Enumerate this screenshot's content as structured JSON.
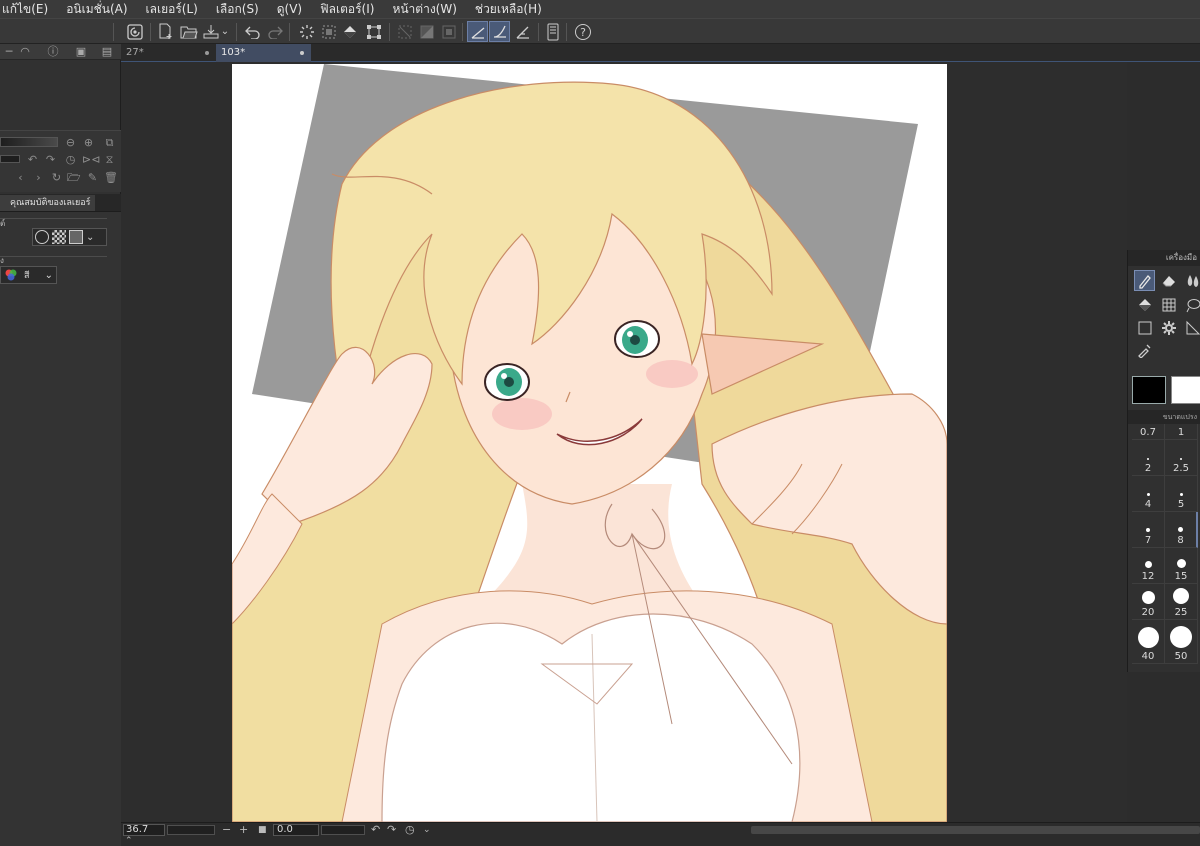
{
  "menu": {
    "items": [
      "แก้ไข(E)",
      "อนิเมชั่น(A)",
      "เลเยอร์(L)",
      "เลือก(S)",
      "ดู(V)",
      "ฟิลเตอร์(I)",
      "หน้าต่าง(W)",
      "ช่วยเหลือ(H)"
    ]
  },
  "toolbar": {
    "icons": [
      "logo-icon",
      "new-file-icon",
      "open-file-icon",
      "save-icon",
      "undo-icon",
      "redo-icon",
      "loading-icon",
      "select-all-icon",
      "fill-icon",
      "transform-icon",
      "deselect-icon",
      "invert-icon",
      "crop-icon",
      "ruler-snap-icon",
      "curve-snap-icon",
      "perspective-snap-icon",
      "device-icon",
      "help-icon"
    ]
  },
  "documents": {
    "tabs": [
      {
        "label": "27*",
        "active": false
      },
      {
        "label": "103*",
        "active": true
      }
    ]
  },
  "layer_properties": {
    "tab_label": "คุณสมบัติของเลเยอร์",
    "effect_label": "ต์",
    "color_label": "ง",
    "color_select_value": "สี"
  },
  "tool_panel": {
    "title": "เครื่องมือ",
    "main_color": "#000000",
    "sub_color": "#ffffff"
  },
  "brush_size_panel": {
    "title": "ขนาดแปรง",
    "sizes": [
      "0.7",
      "1",
      "2",
      "2.5",
      "4",
      "5",
      "7",
      "8",
      "12",
      "15",
      "20",
      "25",
      "40",
      "50"
    ]
  },
  "status": {
    "zoom": "36.7",
    "angle": "0.0"
  },
  "colors": {
    "accent": "#4a5a78",
    "canvas_bg": "#2d2d2d",
    "hair": "#f1dea1",
    "eyes": "#3aa98a"
  }
}
